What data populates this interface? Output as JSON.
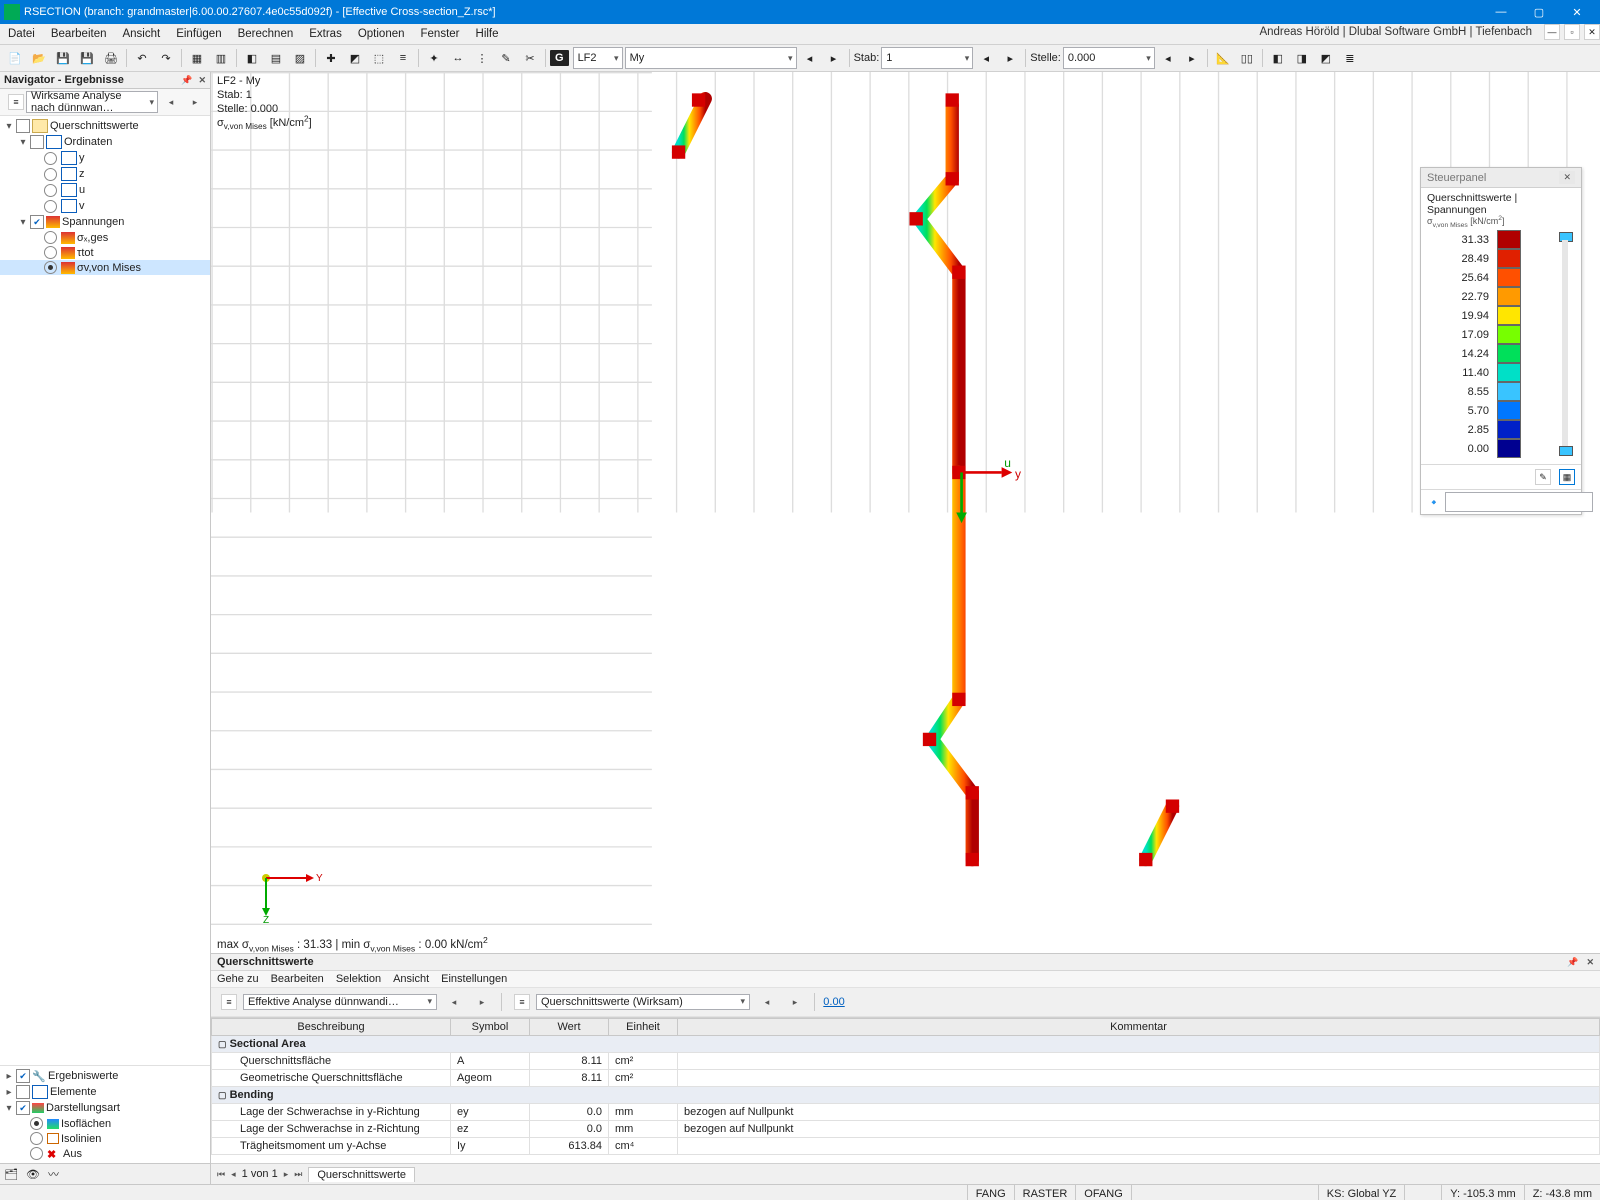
{
  "title": "RSECTION (branch: grandmaster|6.00.00.27607.4e0c55d092f) - [Effective Cross-section_Z.rsc*]",
  "menus": [
    "Datei",
    "Bearbeiten",
    "Ansicht",
    "Einfügen",
    "Berechnen",
    "Extras",
    "Optionen",
    "Fenster",
    "Hilfe"
  ],
  "userline": "Andreas Höröld | Dlubal Software GmbH | Tiefenbach",
  "toolbar": {
    "load_badge": "G",
    "load_case": "LF2",
    "load_name": "My",
    "stab_label": "Stab:",
    "stab_value": "1",
    "stelle_label": "Stelle:",
    "stelle_value": "0.000"
  },
  "navigator": {
    "title": "Navigator - Ergebnisse",
    "combo": "Wirksame Analyse nach dünnwan…",
    "root1": "Querschnittswerte",
    "ord": "Ordinaten",
    "ord_items": [
      "y",
      "z",
      "u",
      "v"
    ],
    "stress": "Spannungen",
    "stress_items": [
      "σₓ,ges",
      "τtot",
      "σv,von Mises"
    ],
    "bottom": {
      "r1": "Ergebniswerte",
      "r2": "Elemente",
      "r3": "Darstellungsart",
      "d1": "Isoflächen",
      "d2": "Isolinien",
      "d3": "Aus"
    }
  },
  "canvas": {
    "line1": "LF2 - My",
    "line2": "Stab: 1",
    "line3": "Stelle: 0.000",
    "result_label_html": "σ<sub>v,von Mises</sub> [kN/cm<sup>2</sup>]",
    "minmax_html": "max σ<sub>v,von Mises</sub> : 31.33 | min σ<sub>v,von Mises</sub> : 0.00 kN/cm<sup>2</sup>"
  },
  "panel": {
    "title": "Steuerpanel",
    "subtitle": "Querschnittswerte | Spannungen",
    "unit_html": "σ<sub>v,von Mises</sub> [kN/cm<sup>2</sup>]",
    "legend": [
      {
        "v": "31.33",
        "c": "#b00000"
      },
      {
        "v": "28.49",
        "c": "#e02000"
      },
      {
        "v": "25.64",
        "c": "#ff5000"
      },
      {
        "v": "22.79",
        "c": "#ff9a00"
      },
      {
        "v": "19.94",
        "c": "#ffe600"
      },
      {
        "v": "17.09",
        "c": "#77ff00"
      },
      {
        "v": "14.24",
        "c": "#00e05a"
      },
      {
        "v": "11.40",
        "c": "#00e0c7"
      },
      {
        "v": "8.55",
        "c": "#39c4ff"
      },
      {
        "v": "5.70",
        "c": "#0077ff"
      },
      {
        "v": "2.85",
        "c": "#0020c7"
      },
      {
        "v": "0.00",
        "c": "#000090"
      }
    ]
  },
  "bottom": {
    "title": "Querschnittswerte",
    "menus": [
      "Gehe zu",
      "Bearbeiten",
      "Selektion",
      "Ansicht",
      "Einstellungen"
    ],
    "combo1": "Effektive Analyse dünnwandi…",
    "combo2": "Querschnittswerte (Wirksam)",
    "headers": [
      "Beschreibung",
      "Symbol",
      "Wert",
      "Einheit",
      "Kommentar"
    ],
    "sections": [
      {
        "name": "Sectional Area",
        "rows": [
          {
            "b": "Querschnittsfläche",
            "s": "A",
            "w": "8.11",
            "e": "cm²",
            "k": ""
          },
          {
            "b": "Geometrische Querschnittsfläche",
            "s": "Ageom",
            "w": "8.11",
            "e": "cm²",
            "k": ""
          }
        ]
      },
      {
        "name": "Bending",
        "rows": [
          {
            "b": "Lage der Schwerachse in y-Richtung",
            "s": "ey",
            "w": "0.0",
            "e": "mm",
            "k": "bezogen auf Nullpunkt"
          },
          {
            "b": "Lage der Schwerachse in z-Richtung",
            "s": "ez",
            "w": "0.0",
            "e": "mm",
            "k": "bezogen auf Nullpunkt"
          },
          {
            "b": "Trägheitsmoment um y-Achse",
            "s": "Iy",
            "w": "613.84",
            "e": "cm⁴",
            "k": ""
          }
        ]
      }
    ],
    "pager": "1 von 1",
    "tab": "Querschnittswerte"
  },
  "status": {
    "fang": "FANG",
    "raster": "RASTER",
    "ofang": "OFANG",
    "ks": "KS: Global YZ",
    "y": "Y: -105.3 mm",
    "z": "Z: -43.8 mm"
  }
}
